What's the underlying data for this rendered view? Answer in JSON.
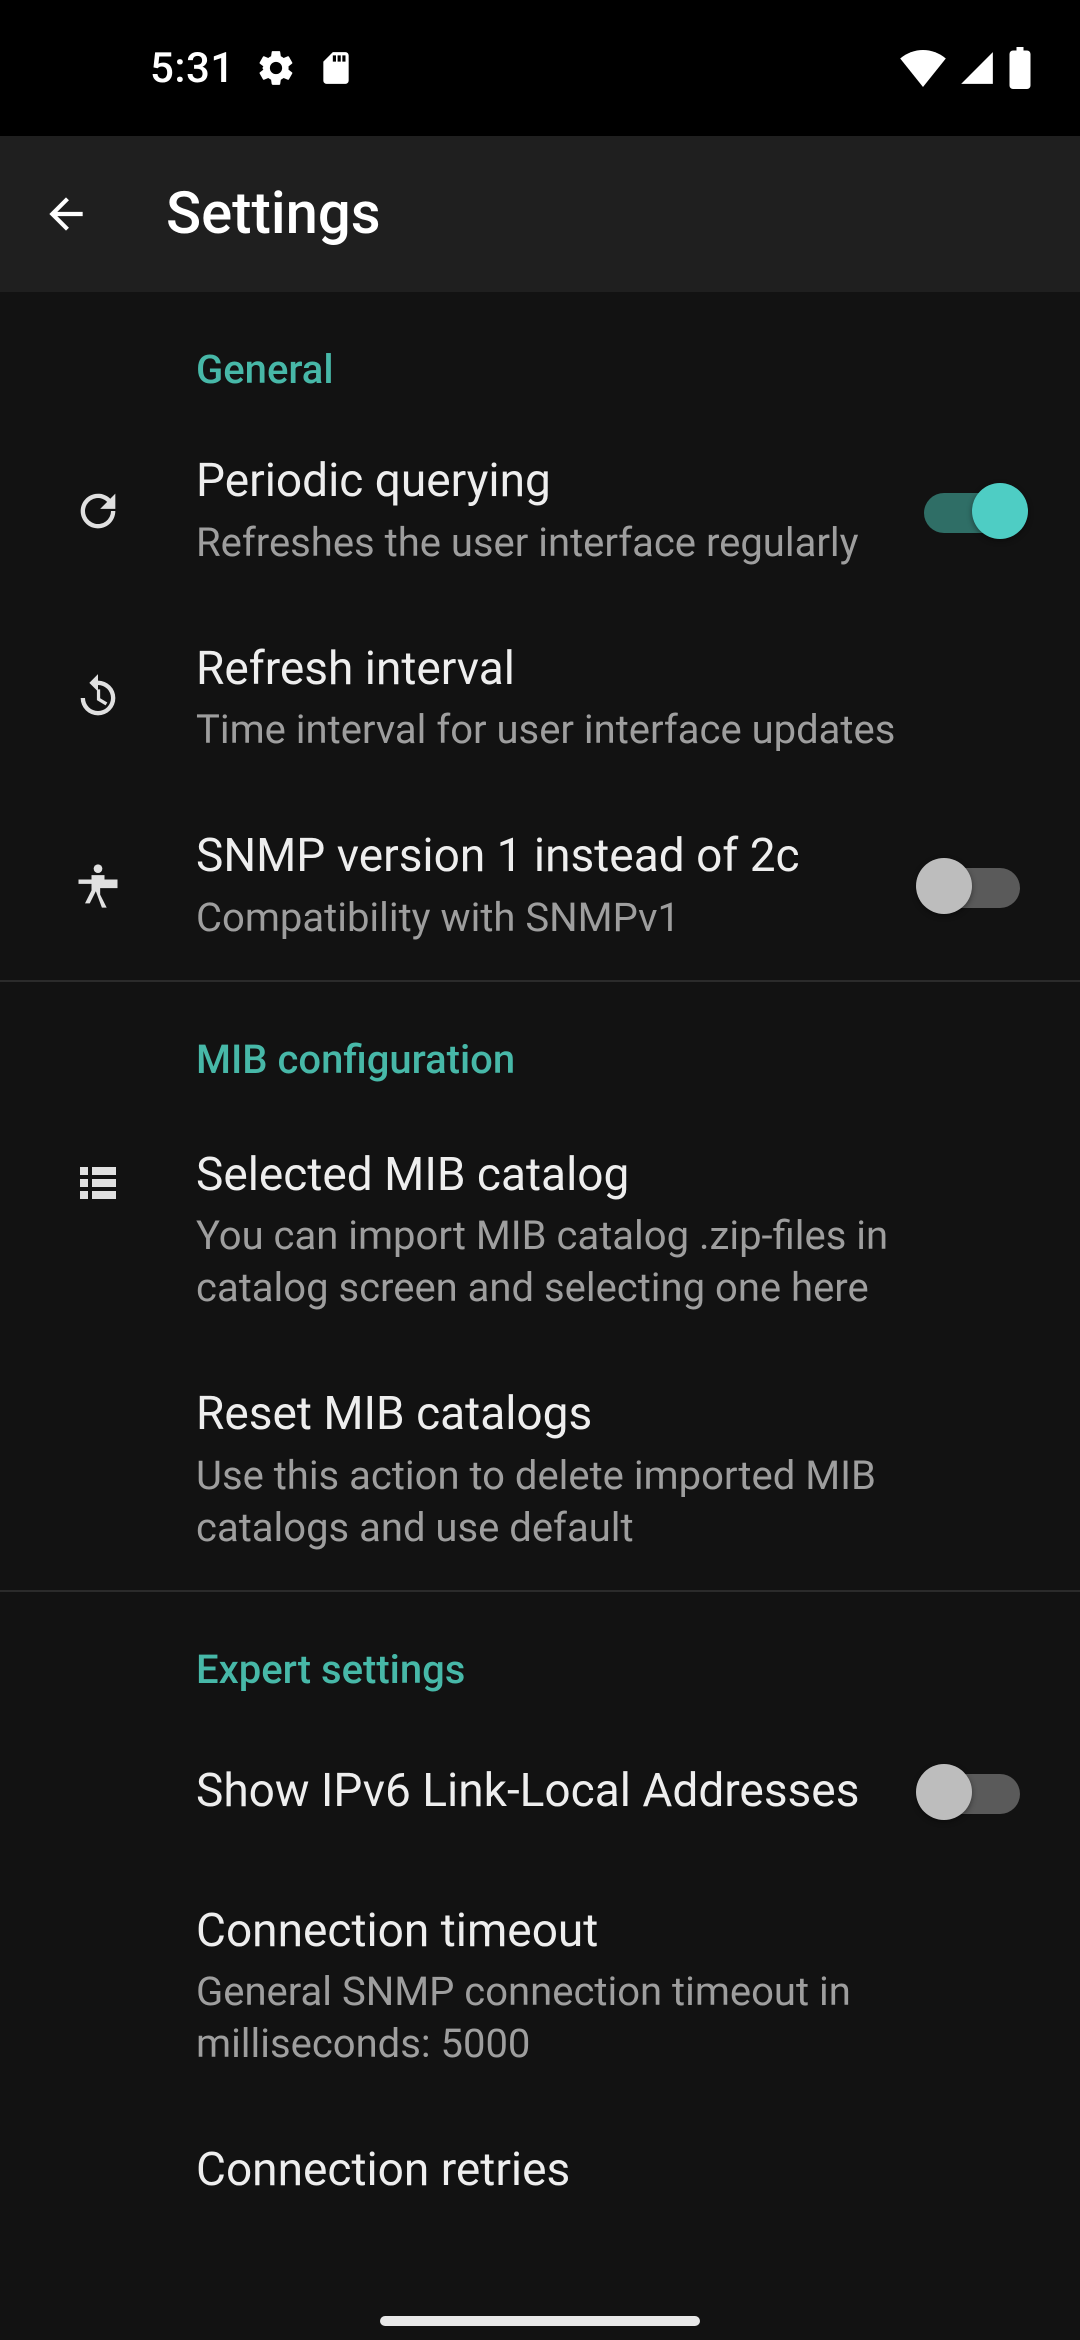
{
  "status": {
    "time": "5:31"
  },
  "header": {
    "title": "Settings"
  },
  "sections": {
    "general": {
      "label": "General",
      "periodic_querying": {
        "title": "Periodic querying",
        "sub": "Refreshes the user interface regularly",
        "on": true
      },
      "refresh_interval": {
        "title": "Refresh interval",
        "sub": "Time interval for user interface updates"
      },
      "snmp_v1": {
        "title": "SNMP version 1 instead of 2c",
        "sub": "Compatibility with SNMPv1",
        "on": false
      }
    },
    "mib": {
      "label": "MIB configuration",
      "selected_catalog": {
        "title": "Selected MIB catalog",
        "sub": "You can import MIB catalog .zip-files in catalog screen and selecting one here"
      },
      "reset_catalogs": {
        "title": "Reset MIB catalogs",
        "sub": "Use this action to delete imported MIB catalogs and use default"
      }
    },
    "expert": {
      "label": "Expert settings",
      "show_ipv6": {
        "title": "Show IPv6 Link-Local Addresses",
        "on": false
      },
      "conn_timeout": {
        "title": "Connection timeout",
        "sub": "General SNMP connection timeout in milliseconds: 5000"
      },
      "conn_retries": {
        "title": "Connection retries"
      }
    }
  }
}
